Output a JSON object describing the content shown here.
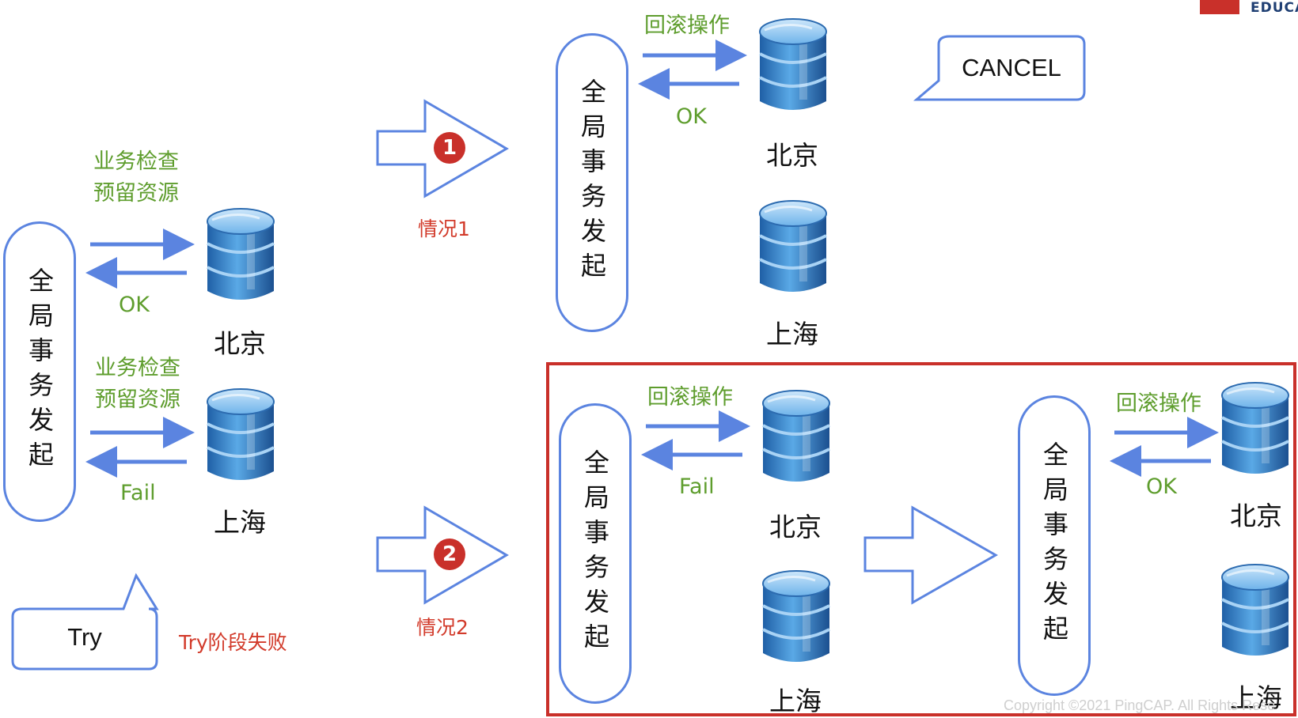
{
  "header": {
    "logo_text": "EDUCA"
  },
  "footer": {
    "copyright": "Copyright ©2021 PingCAP. All Rights Rese"
  },
  "labels": {
    "initiator": "全局事务发起",
    "beijing": "北京",
    "shanghai": "上海",
    "check_reserve": [
      "业务检查",
      "预留资源"
    ],
    "ok": "OK",
    "fail": "Fail",
    "rollback": "回滚操作",
    "case1": "情况1",
    "case2": "情况2",
    "try_failed": "Try阶段失败",
    "badge1": "1",
    "badge2": "2"
  },
  "bubbles": {
    "try": "Try",
    "cancel": "CANCEL"
  },
  "colors": {
    "accent_blue": "#5b84e0",
    "label_green": "#5e9d2d",
    "alert_red": "#c9302a",
    "database_blue": "#3f8fd2"
  },
  "icons": {
    "database": "database-icon",
    "arrow_right": "arrow-right-icon",
    "arrow_left": "arrow-left-icon",
    "block_arrow": "block-arrow-icon",
    "speech_bubble": "speech-bubble-icon"
  }
}
